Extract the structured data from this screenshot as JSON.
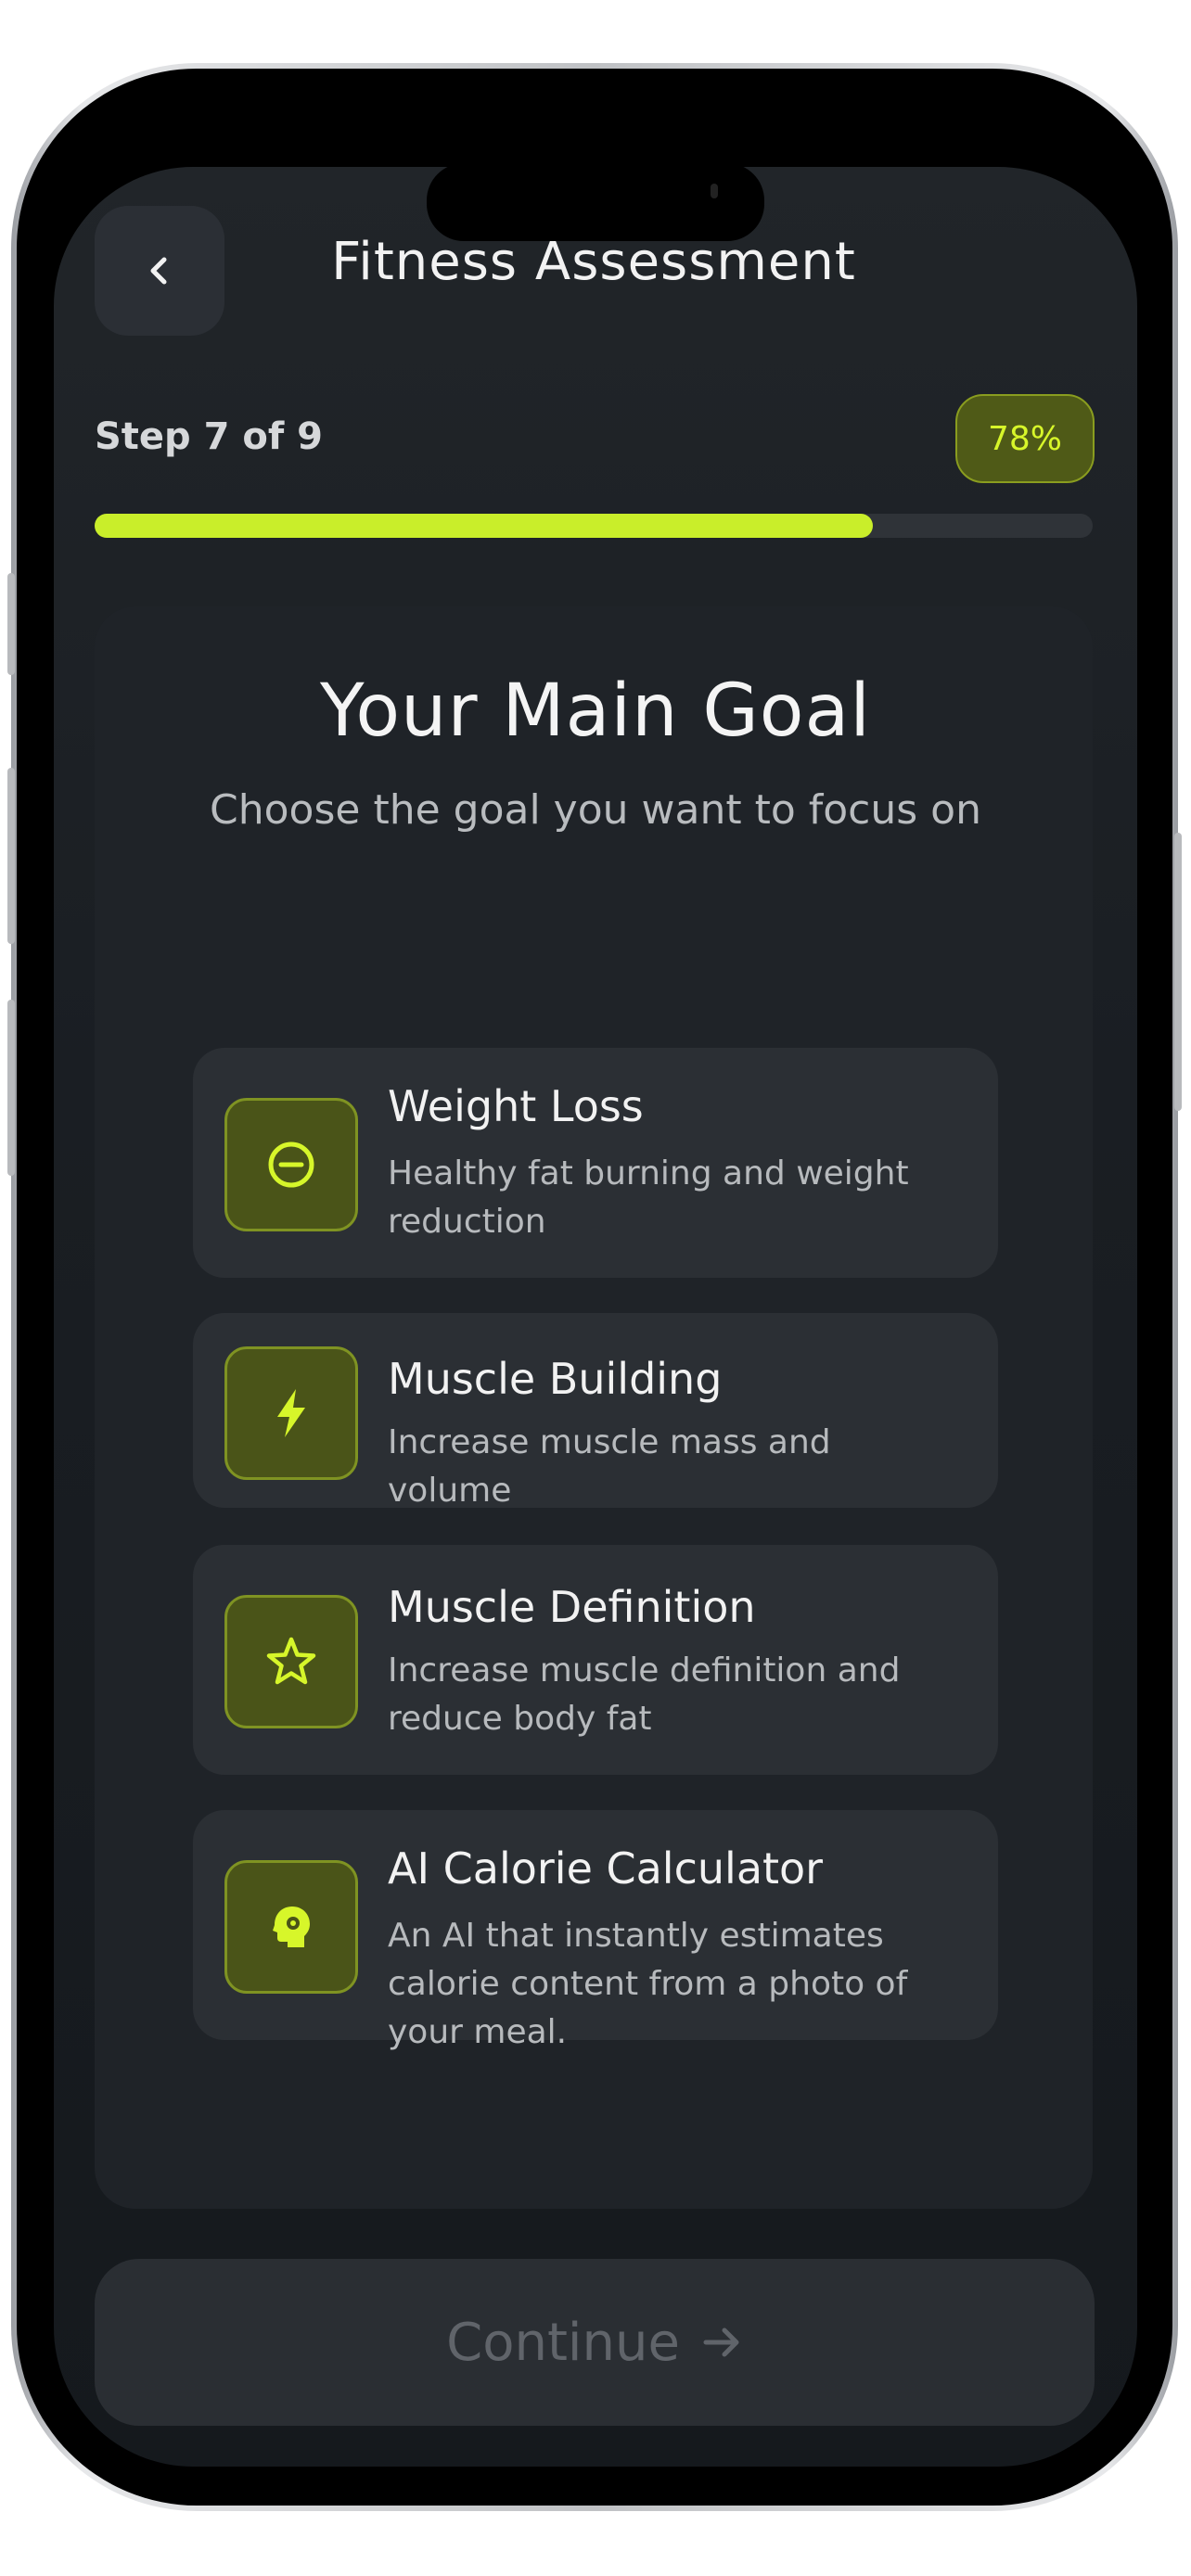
{
  "header": {
    "title": "Fitness Assessment",
    "back_icon": "chevron-left-icon"
  },
  "progress": {
    "step_label": "Step 7 of 9",
    "percent_label": "78%",
    "fraction": 0.78
  },
  "main": {
    "heading": "Your Main Goal",
    "subheading": "Choose the goal you want to focus on"
  },
  "options": [
    {
      "title": "Weight Loss",
      "description": "Healthy fat burning and weight reduction",
      "icon": "minus-circle-icon"
    },
    {
      "title": "Muscle Building",
      "description": "Increase muscle mass and volume",
      "icon": "lightning-icon"
    },
    {
      "title": "Muscle Definition",
      "description": "Increase muscle definition and reduce body fat",
      "icon": "star-icon"
    },
    {
      "title": "AI Calorie Calculator",
      "description": "An AI that instantly estimates calorie content from a photo of your meal.",
      "icon": "ai-head-icon"
    }
  ],
  "footer": {
    "continue_label": "Continue",
    "arrow_icon": "arrow-right-icon"
  },
  "colors": {
    "accent": "#c9ee2a",
    "background": "#1a1e23",
    "card": "#2b2f34"
  }
}
